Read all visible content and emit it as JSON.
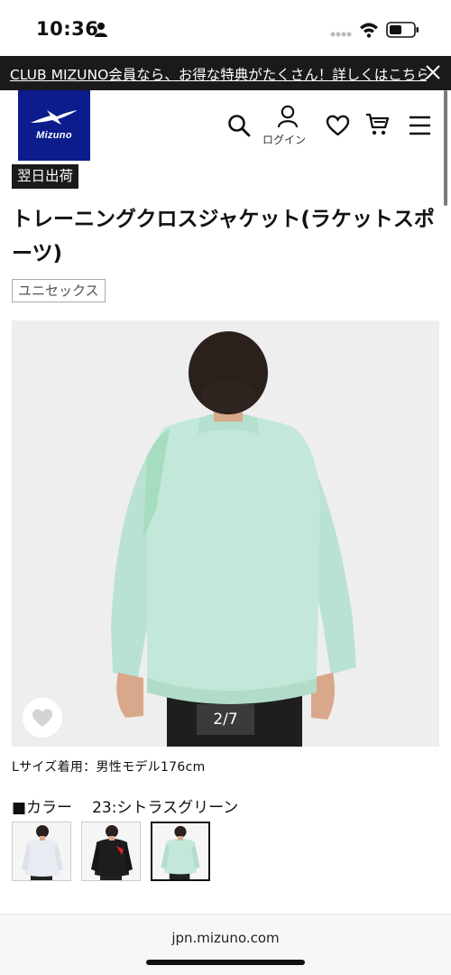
{
  "status_bar": {
    "time": "10:36"
  },
  "promo": {
    "text": "CLUB MIZUNO会員なら、お得な特典がたくさん！詳しくはこちら"
  },
  "header": {
    "logo_text": "Mizuno",
    "login_label": "ログイン"
  },
  "product": {
    "shipping_badge": "翌日出荷",
    "title": "トレーニングクロスジャケット(ラケットスポーツ)",
    "gender": "ユニセックス",
    "image_counter": "2/7",
    "model_note": "Lサイズ着用：男性モデル176cm",
    "color_label": "■カラー",
    "color_value": "23:シトラスグリーン"
  },
  "colors": {
    "brand_blue": "#0c1c8c",
    "jacket_mint": "#bfe6d6"
  },
  "footer": {
    "url": "jpn.mizuno.com"
  }
}
